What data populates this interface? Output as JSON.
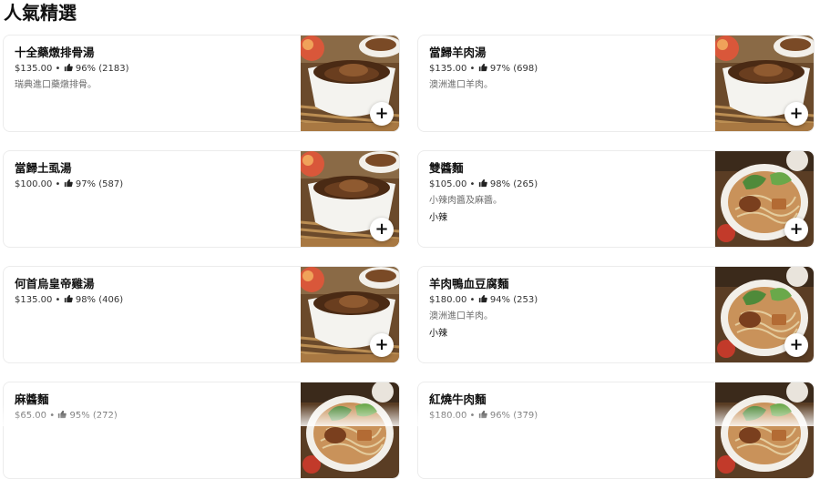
{
  "section": {
    "title": "人氣精選"
  },
  "items": [
    {
      "name": "十全藥燉排骨湯",
      "price": "$135.00",
      "rating": "96% (2183)",
      "desc": "瑞典進口藥燉排骨。",
      "tag": "",
      "photo": "herbal-pork-rib-soup"
    },
    {
      "name": "當歸羊肉湯",
      "price": "$135.00",
      "rating": "97% (698)",
      "desc": "澳洲進口羊肉。",
      "tag": "",
      "photo": "angelica-lamb-soup"
    },
    {
      "name": "當歸土虱湯",
      "price": "$100.00",
      "rating": "97% (587)",
      "desc": "",
      "tag": "",
      "photo": "angelica-catfish-soup"
    },
    {
      "name": "雙醬麵",
      "price": "$105.00",
      "rating": "98% (265)",
      "desc": "小辣肉醬及麻醬。",
      "tag": "小辣",
      "photo": "double-sauce-noodles"
    },
    {
      "name": "何首烏皇帝雞湯",
      "price": "$135.00",
      "rating": "98% (406)",
      "desc": "",
      "tag": "",
      "photo": "herbal-chicken-soup"
    },
    {
      "name": "羊肉鴨血豆腐麵",
      "price": "$180.00",
      "rating": "94% (253)",
      "desc": "澳洲進口羊肉。",
      "tag": "小辣",
      "photo": "lamb-duck-blood-tofu-noodles"
    },
    {
      "name": "麻醬麵",
      "price": "$65.00",
      "rating": "95% (272)",
      "desc": "",
      "tag": "",
      "photo": "sesame-noodles"
    },
    {
      "name": "紅燒牛肉麵",
      "price": "$180.00",
      "rating": "96% (379)",
      "desc": "",
      "tag": "",
      "photo": "braised-beef-noodles"
    }
  ],
  "ui": {
    "separator": "•",
    "add_symbol": "+",
    "thumb_icon": "thumbs-up-icon",
    "add_icon": "plus-icon"
  }
}
